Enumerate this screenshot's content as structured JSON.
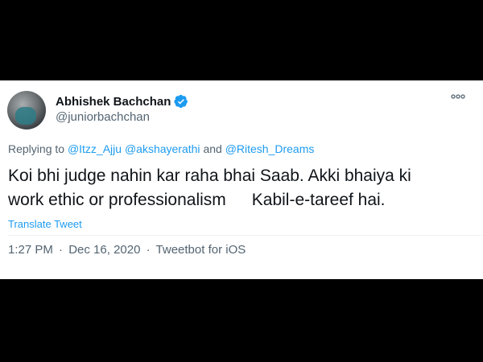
{
  "author": {
    "name": "Abhishek Bachchan",
    "handle": "@juniorbachchan",
    "verified_icon": "verified-badge-icon"
  },
  "reply": {
    "prefix": "Replying to",
    "mention1": "@Itzz_Ajju",
    "mention2": "@akshayerathi",
    "and": "and",
    "mention3": "@Ritesh_Dreams"
  },
  "tweet": {
    "line1": "Koi bhi judge nahin kar raha bhai Saab. Akki bhaiya ki",
    "line2a": "work ethic or professionalism",
    "line2b": "Kabil-e-tareef hai."
  },
  "translate_label": "Translate Tweet",
  "meta": {
    "time": "1:27 PM",
    "date": "Dec 16, 2020",
    "source": "Tweetbot for iOS",
    "separator": "·"
  },
  "colors": {
    "link": "#1d9bf0",
    "text": "#0f1419",
    "secondary": "#536471",
    "background_band": "#000000"
  }
}
